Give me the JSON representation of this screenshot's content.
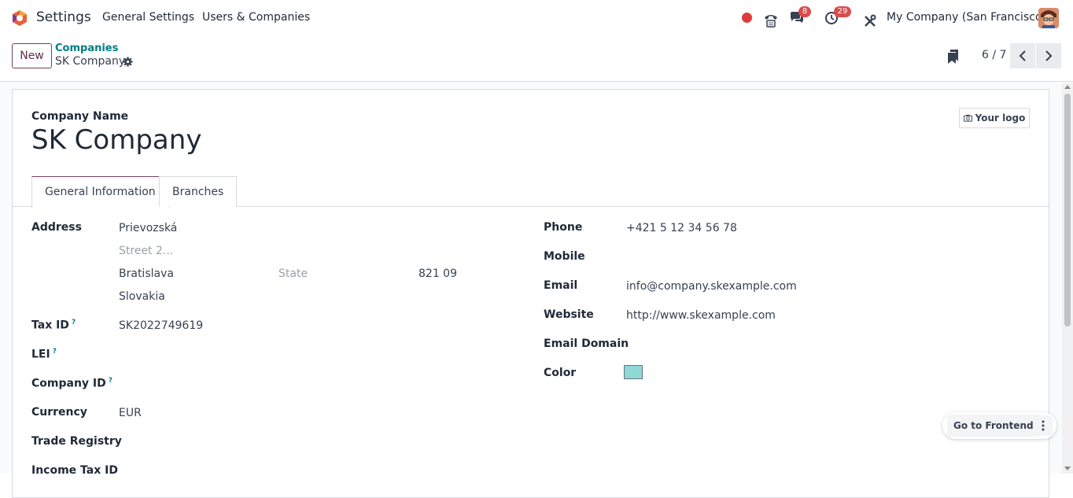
{
  "navbar": {
    "app_name": "Settings",
    "menu": [
      "General Settings",
      "Users & Companies"
    ],
    "activity_count": "8",
    "clock_count": "29",
    "company": "My Company (San Francisco)",
    "icons": [
      "status-dot-icon",
      "phone-icon",
      "chat-icon",
      "clock-icon",
      "tools-icon"
    ],
    "status_color": "#e03b3b"
  },
  "control": {
    "new_label": "New",
    "breadcrumb_parent": "Companies",
    "breadcrumb_current": "SK Company",
    "pager": "6 / 7"
  },
  "form": {
    "name_label": "Company Name",
    "name_value": "SK Company",
    "logo_label": "Your logo",
    "tabs": [
      "General Information",
      "Branches"
    ],
    "left": {
      "address_label": "Address",
      "street": "Prievozská",
      "street2_placeholder": "Street 2...",
      "city": "Bratislava",
      "state_placeholder": "State",
      "zip": "821 09",
      "country": "Slovakia",
      "tax_id_label": "Tax ID",
      "tax_id": "SK2022749619",
      "lei_label": "LEI",
      "company_id_label": "Company ID",
      "currency_label": "Currency",
      "currency": "EUR",
      "trade_registry_label": "Trade Registry",
      "income_tax_label": "Income Tax ID",
      "help_mark": "?"
    },
    "right": {
      "phone_label": "Phone",
      "phone": "+421 5 12 34 56 78",
      "mobile_label": "Mobile",
      "email_label": "Email",
      "email": "info@company.skexample.com",
      "website_label": "Website",
      "website": "http://www.skexample.com",
      "email_domain_label": "Email Domain",
      "color_label": "Color",
      "color_value": "#8fd8d6"
    }
  },
  "floating": {
    "frontend_label": "Go to Frontend"
  }
}
